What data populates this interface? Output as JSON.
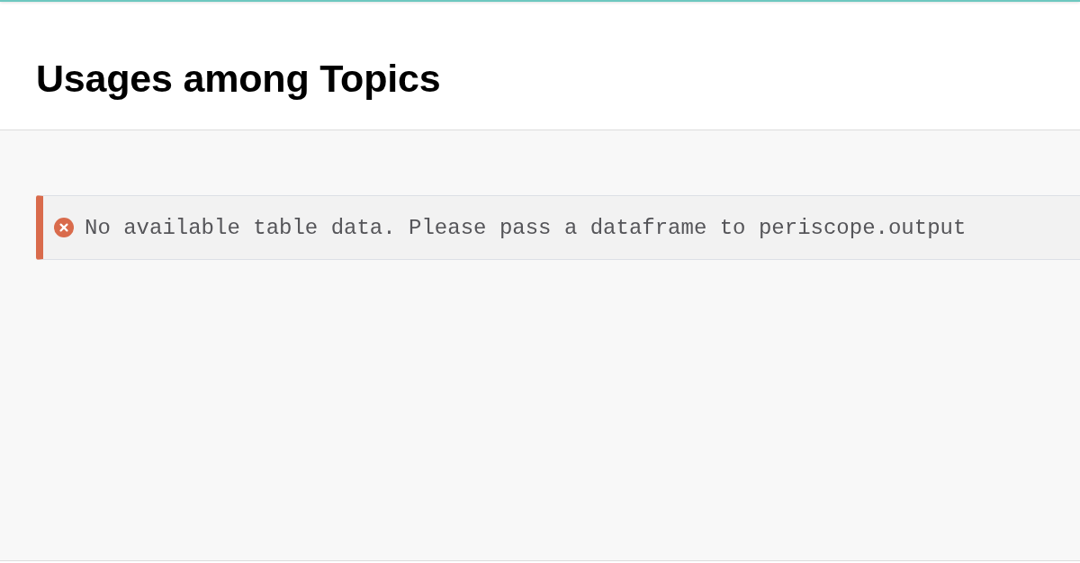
{
  "page": {
    "title": "Usages among Topics"
  },
  "alert": {
    "kind": "error",
    "message": "No available table data. Please pass a dataframe to periscope.output"
  }
}
